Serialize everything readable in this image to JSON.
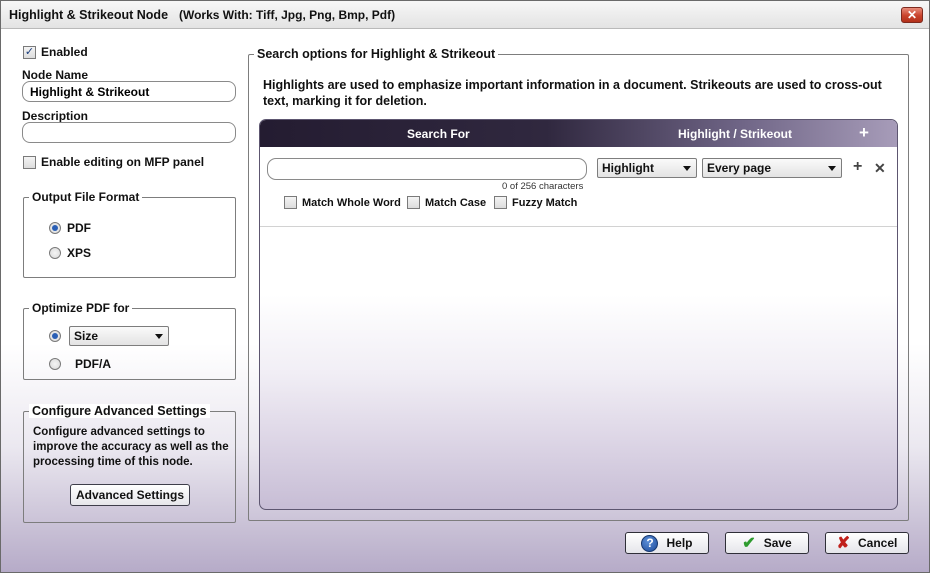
{
  "window": {
    "title": "Highlight & Strikeout Node",
    "works_with": "(Works With: Tiff, Jpg, Png, Bmp, Pdf)",
    "close_glyph": "✕"
  },
  "left": {
    "enabled_label": "Enabled",
    "enabled_checked": true,
    "node_name_label": "Node Name",
    "node_name_value": "Highlight & Strikeout",
    "description_label": "Description",
    "description_value": "",
    "mfp_label": "Enable editing on MFP panel",
    "mfp_checked": false,
    "output_format": {
      "legend": "Output File Format",
      "options": [
        "PDF",
        "XPS"
      ],
      "selected": "PDF"
    },
    "optimize": {
      "legend": "Optimize PDF for",
      "size_value": "Size",
      "pdfa_label": "PDF/A",
      "selected": "Size"
    },
    "advanced": {
      "legend": "Configure Advanced Settings",
      "text": "Configure advanced settings to improve the accuracy as well as the processing time of this node.",
      "button_label": "Advanced Settings"
    }
  },
  "right": {
    "legend": "Search options for Highlight & Strikeout",
    "description": "Highlights are used to emphasize important information in a document. Strikeouts are used to cross-out text, marking it for deletion.",
    "header": {
      "search_for": "Search For",
      "highlight_strikeout": "Highlight / Strikeout",
      "add_glyph": "+"
    },
    "row": {
      "search_value": "",
      "char_count": "0 of 256 characters",
      "mode_value": "Highlight",
      "pages_value": "Every page",
      "add_glyph": "+",
      "remove_glyph": "✕",
      "match_whole_word": "Match Whole Word",
      "match_case": "Match Case",
      "fuzzy_match": "Fuzzy Match"
    }
  },
  "footer": {
    "help_label": "Help",
    "help_glyph": "?",
    "save_label": "Save",
    "save_glyph": "✔",
    "cancel_label": "Cancel",
    "cancel_glyph": "✘"
  },
  "colors": {
    "header_dark": "#241c31",
    "header_light": "#a79cb9",
    "save_green": "#2e9b2e",
    "cancel_red": "#c0201b",
    "radio_blue": "#2a5fb5"
  }
}
